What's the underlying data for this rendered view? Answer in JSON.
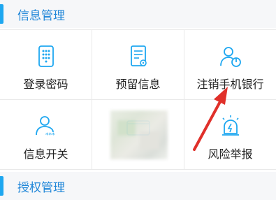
{
  "sections": {
    "info": {
      "title": "信息管理"
    },
    "auth": {
      "title": "授权管理"
    }
  },
  "grid": {
    "items": [
      {
        "label": "登录密码",
        "icon": "keypad-icon"
      },
      {
        "label": "预留信息",
        "icon": "document-icon"
      },
      {
        "label": "注销手机银行",
        "icon": "user-power-icon"
      },
      {
        "label": "信息开关",
        "icon": "user-password-icon"
      },
      {
        "label": "",
        "icon": "phone-icon"
      },
      {
        "label": "风险举报",
        "icon": "alarm-light-icon"
      }
    ]
  },
  "colors": {
    "accent": "#1ea7f0",
    "header_text": "#1f86d8",
    "arrow": "#e0302a"
  }
}
